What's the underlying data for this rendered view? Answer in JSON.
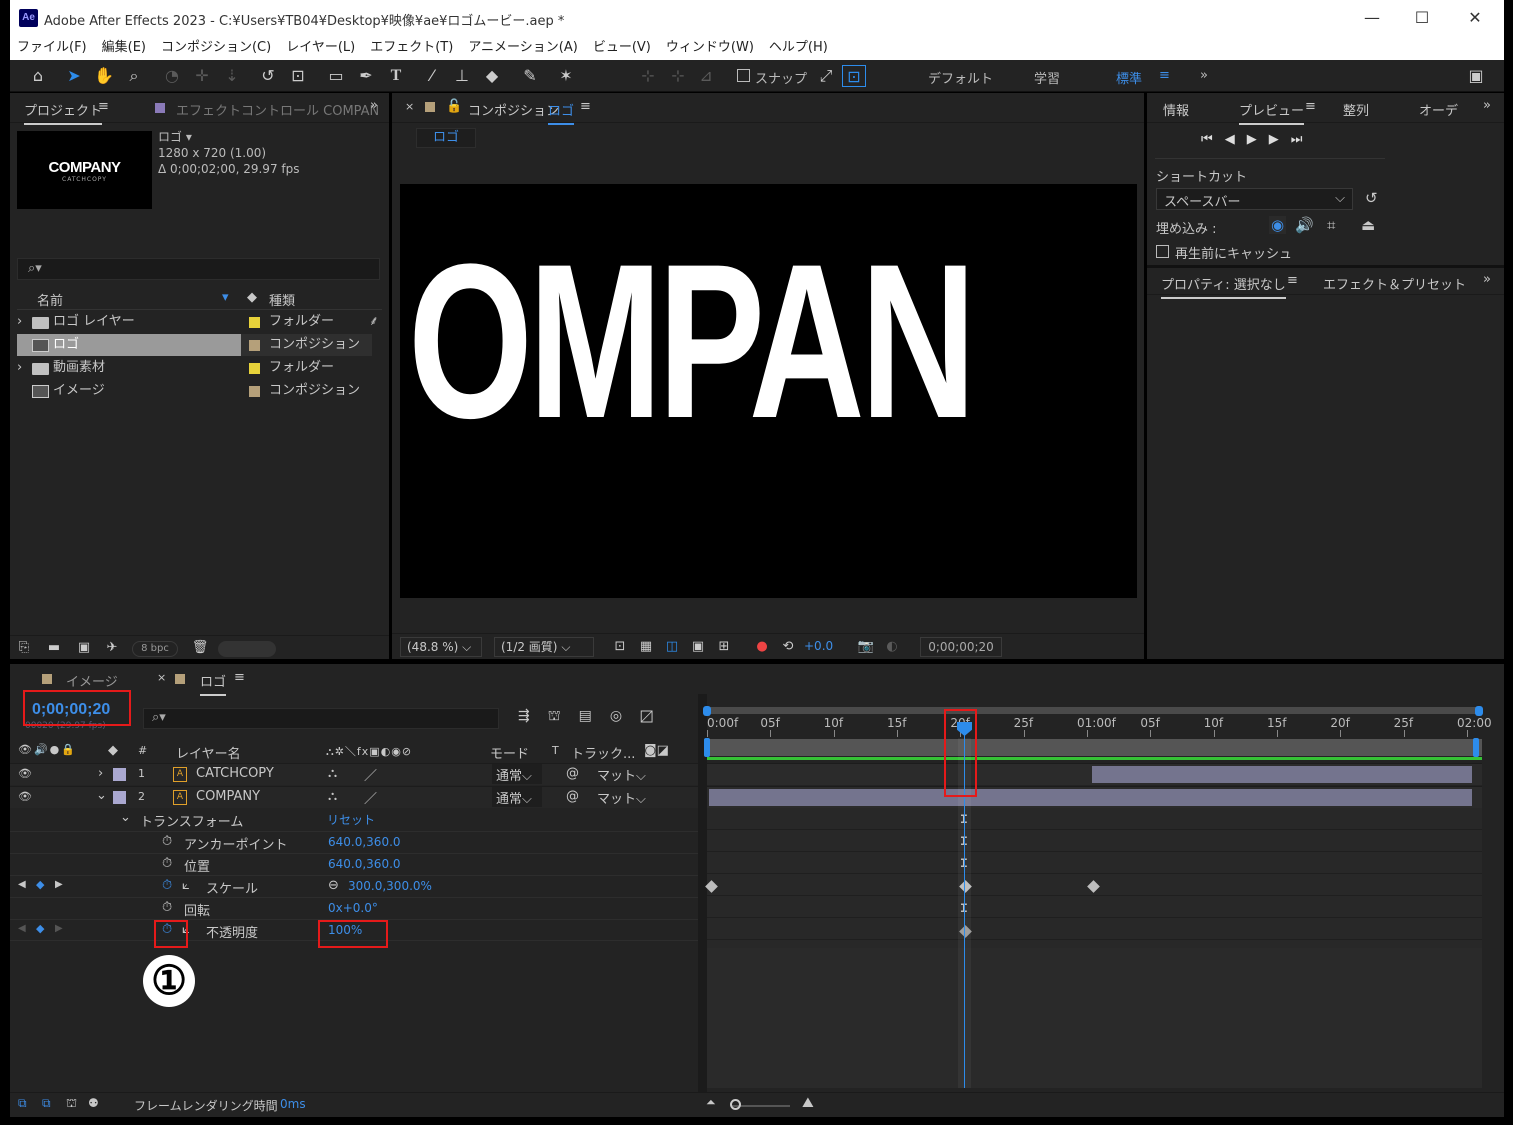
{
  "window": {
    "app_icon": "Ae",
    "title": "Adobe After Effects 2023 - C:¥Users¥TB04¥Desktop¥映像¥ae¥ロゴムービー.aep *",
    "minimize": "—",
    "maximize": "☐",
    "close": "✕"
  },
  "menu": [
    "ファイル(F)",
    "編集(E)",
    "コンポジション(C)",
    "レイヤー(L)",
    "エフェクト(T)",
    "アニメーション(A)",
    "ビュー(V)",
    "ウィンドウ(W)",
    "ヘルプ(H)"
  ],
  "toolbar": {
    "snap_label": "スナップ",
    "workspaces": [
      "デフォルト",
      "学習",
      "標準"
    ],
    "active_workspace": "標準",
    "more": "»"
  },
  "project": {
    "tab_label": "プロジェクト",
    "effect_tab_label": "エフェクトコントロール COMPAN",
    "thumb_title": "COMPANY",
    "thumb_sub": "CATCHCOPY",
    "info_name": "ロゴ ▾",
    "info_size": "1280 x 720 (1.00)",
    "info_duration": "Δ 0;00;02;00, 29.97 fps",
    "search_placeholder": "⌕▾",
    "col_name": "名前",
    "col_type": "種類",
    "items": [
      {
        "name": "ロゴ レイヤー",
        "type": "フォルダー",
        "kind": "folder",
        "color": "#e7d23a"
      },
      {
        "name": "ロゴ",
        "type": "コンポジション",
        "kind": "comp",
        "color": "#b5a07a"
      },
      {
        "name": "動画素材",
        "type": "フォルダー",
        "kind": "folder",
        "color": "#e7d23a"
      },
      {
        "name": "イメージ",
        "type": "コンポジション",
        "kind": "comp",
        "color": "#b5a07a"
      }
    ],
    "bpc": "8 bpc"
  },
  "composition": {
    "tab_label": "コンポジション",
    "tab_comp_name": "ロゴ",
    "breadcrumb": "ロゴ",
    "preview_text": "OMPAN",
    "zoom": "(48.8 %)",
    "resolution": "(1/2 画質)",
    "exposure": "+0.0",
    "timecode": "0;00;00;20"
  },
  "right_panel": {
    "tabs": [
      "情報",
      "プレビュー",
      "整列",
      "オーデ"
    ],
    "active_tab": "プレビュー",
    "shortcut_label": "ショートカット",
    "shortcut_value": "スペースバー",
    "embed_label": "埋め込み :",
    "cache_label": "再生前にキャッシュ",
    "props_tab": "プロパティ: 選択なし",
    "effects_tab": "エフェクト＆プリセット"
  },
  "timeline": {
    "tab_image": "イメージ",
    "tab_comp": "ロゴ",
    "current_time": "0;00;00;20",
    "frame_info": "00020 (29.97 fps)",
    "columns": {
      "layer_name": "レイヤー名",
      "mode": "モード",
      "track": "トラック..."
    },
    "layers": [
      {
        "num": "1",
        "name": "CATCHCOPY",
        "mode": "通常",
        "matte": "マット",
        "color": "#aaa8d0"
      },
      {
        "num": "2",
        "name": "COMPANY",
        "mode": "通常",
        "matte": "マット",
        "color": "#aaa8d0"
      }
    ],
    "transform_label": "トランスフォーム",
    "reset_label": "リセット",
    "properties": [
      {
        "name": "アンカーポイント",
        "value": "640.0,360.0"
      },
      {
        "name": "位置",
        "value": "640.0,360.0"
      },
      {
        "name": "スケール",
        "value": "300.0,300.0%"
      },
      {
        "name": "回転",
        "value": "0x+0.0°"
      },
      {
        "name": "不透明度",
        "value": "100%"
      }
    ],
    "ruler": [
      "0:00f",
      "05f",
      "10f",
      "15f",
      "20f",
      "25f",
      "01:00f",
      "05f",
      "10f",
      "15f",
      "20f",
      "25f",
      "02:00"
    ],
    "annotation": "①",
    "render_time_label": "フレームレンダリング時間",
    "render_time_value": "0ms"
  }
}
